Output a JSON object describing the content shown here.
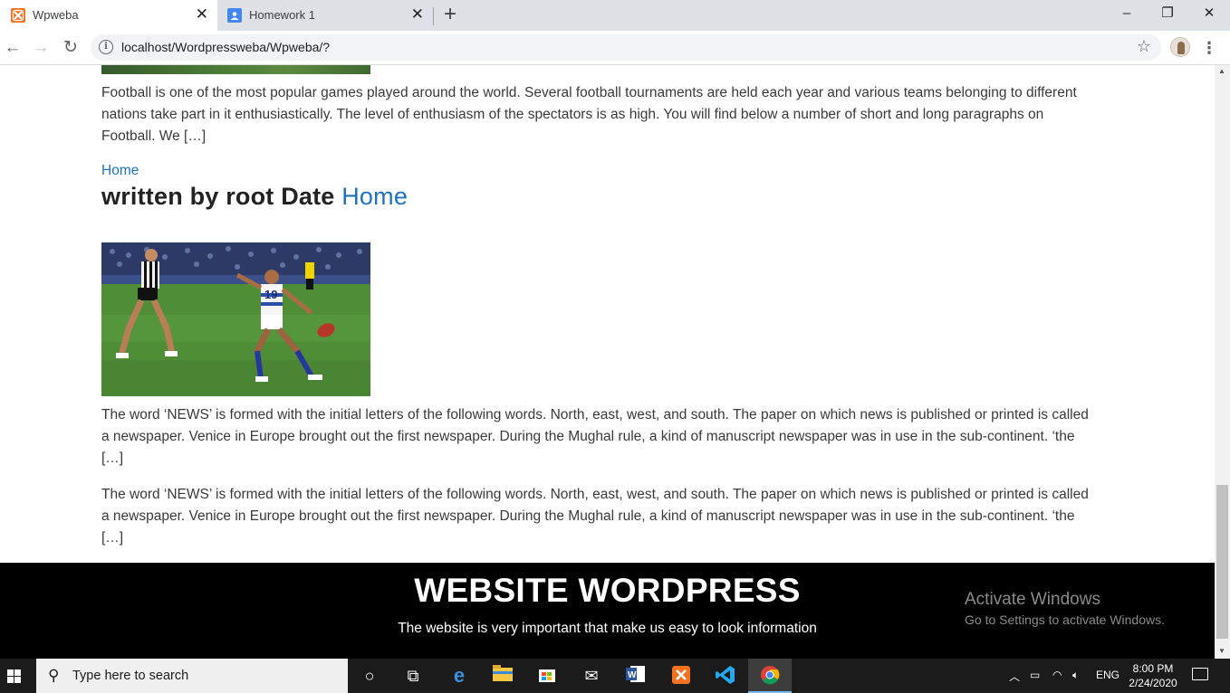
{
  "browser": {
    "tabs": [
      {
        "title": "Wpweba",
        "favicon_color": "#f4711f",
        "active": true
      },
      {
        "title": "Homework 1",
        "favicon_color": "#4285f4",
        "active": false
      }
    ],
    "url": "localhost/Wordpressweba/Wpweba/?"
  },
  "content": {
    "post1_excerpt": "Football is one of the most popular games played around the world. Several football tournaments are held each year and various teams belonging to different nations take part in it enthusiastically. The level of enthusiasm of the spectators is as high. You will find below a number of short and long paragraphs on Football. We […]",
    "category_link": "Home",
    "meta_prefix": "written by root Date ",
    "meta_link": "Home",
    "post2_excerpt": "The word ‘NEWS’ is formed with the initial letters of the following words. North, east, west, and south. The paper on which news is published or printed is called a newspaper. Venice in Europe brought out the first newspaper. During the Mughal rule, a kind of manuscript newspaper was in use in the sub-continent. ‘the […]",
    "post3_excerpt": "The word ‘NEWS’ is formed with the initial letters of the following words. North, east, west, and south. The paper on which news is published or printed is called a newspaper. Venice in Europe brought out the first newspaper. During the Mughal rule, a kind of manuscript newspaper was in use in the sub-continent. ‘the […]"
  },
  "footer": {
    "title": "WEBSITE WORDPRESS",
    "subtitle": "The website is very important that make us easy to look information"
  },
  "watermark": {
    "title": "Activate Windows",
    "subtitle": "Go to Settings to activate Windows."
  },
  "taskbar": {
    "search_placeholder": "Type here to search",
    "language": "ENG",
    "time": "8:00 PM",
    "date": "2/24/2020"
  },
  "colors": {
    "link": "#1e73be",
    "footer_bg": "#000000",
    "taskbar_bg": "#1b1b1b"
  }
}
